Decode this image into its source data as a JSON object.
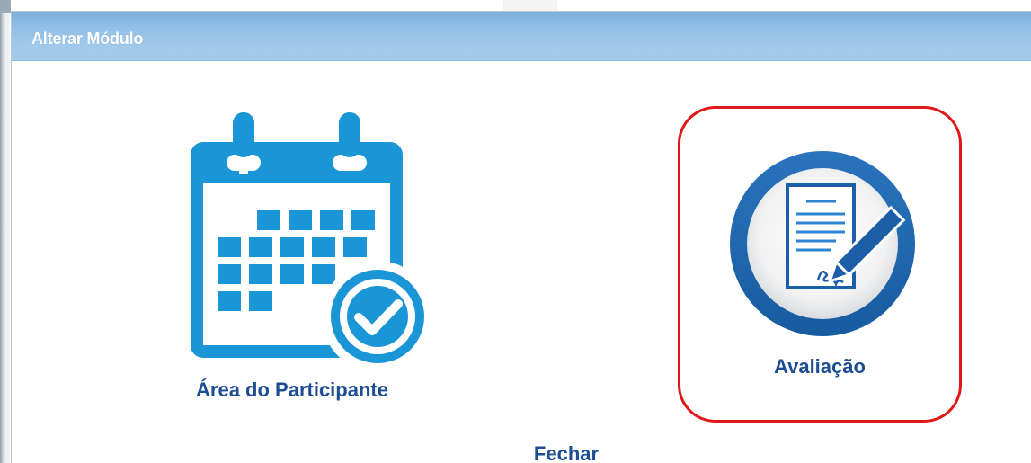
{
  "dialog": {
    "title": "Alterar Módulo",
    "close_label": "Fechar"
  },
  "modules": [
    {
      "label": "Área do Participante",
      "icon": "calendar-check-icon"
    },
    {
      "label": "Avaliação",
      "icon": "document-signature-icon",
      "highlighted": true
    }
  ],
  "colors": {
    "titlebar": "#8fbde5",
    "icon_blue": "#1a96d6",
    "dark_blue": "#1c5fa8",
    "label_text": "#1d4e93",
    "highlight": "#e01818"
  }
}
